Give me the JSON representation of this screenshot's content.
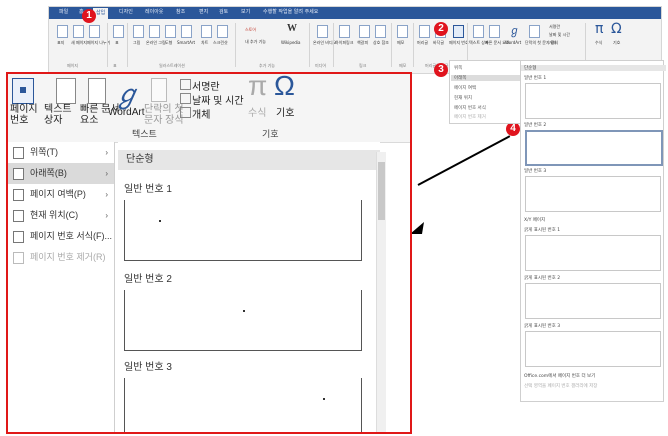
{
  "top_ribbon": {
    "tabs": [
      "파일",
      "홈",
      "삽입",
      "디자인",
      "레이아웃",
      "참조",
      "편지",
      "검토",
      "보기",
      "수행할 작업을 알려 주세요"
    ],
    "buttons": [
      "표지",
      "새 페이지",
      "페이지 나누기",
      "표",
      "그림",
      "온라인 그림",
      "도형",
      "SmartArt",
      "차트",
      "스크린샷",
      "스토어",
      "내 추가 기능",
      "Wikipedia",
      "온라인 비디오",
      "하이퍼링크",
      "책갈피",
      "상호 참조",
      "메모",
      "머리글",
      "바닥글",
      "페이지 번호",
      "텍스트 상자",
      "빠른 문서 요소",
      "WordArt",
      "단락의 첫 문자 장식",
      "서명란",
      "날짜 및 시간",
      "개체",
      "수식",
      "기호"
    ],
    "groups": [
      "페이지",
      "표",
      "일러스트레이션",
      "추가 기능",
      "미디어",
      "링크",
      "메모",
      "머리글/바닥글",
      "텍스트",
      "기호"
    ]
  },
  "badges": [
    "1",
    "2",
    "3",
    "4"
  ],
  "small_dropdown": [
    "위쪽",
    "아래쪽",
    "페이지 여백",
    "현재 위치",
    "페이지 번호 서식",
    "페이지 번호 제거"
  ],
  "small_gallery": {
    "head": "단순형",
    "items": [
      "일반 번호 1",
      "일반 번호 2",
      "일반 번호 3"
    ],
    "section": "X/Y 페이지",
    "bold_items": [
      "굵게 표시된 번호 1",
      "굵게 표시된 번호 2",
      "굵게 표시된 번호 3"
    ],
    "footer": [
      "Office.com에서 페이지 번호 더 보기",
      "선택 영역을 페이지 번호 갤러리에 저장"
    ]
  },
  "zoom": {
    "ribbon": {
      "page_number": "페이지\n번호",
      "text_box": "텍스트\n상자",
      "quick_parts": "빠른 문서\n요소",
      "wordart": "WordArt",
      "dropcap": "단락의 첫\n문자 장식",
      "signature": "서명란",
      "datetime": "날짜 및 시간",
      "object": "개체",
      "equation": "수식",
      "symbol": "기호",
      "group_text": "텍스트",
      "group_symbol": "기호"
    },
    "menu": [
      {
        "label": "위쪽(T)",
        "chevron": "›"
      },
      {
        "label": "아래쪽(B)",
        "chevron": "›"
      },
      {
        "label": "페이지 여백(P)",
        "chevron": "›"
      },
      {
        "label": "현재 위치(C)",
        "chevron": "›"
      },
      {
        "label": "페이지 번호 서식(F)...",
        "chevron": ""
      },
      {
        "label": "페이지 번호 제거(R)",
        "chevron": ""
      }
    ],
    "gallery_head": "단순형",
    "gallery_items": [
      "일반 번호 1",
      "일반 번호 2",
      "일반 번호 3"
    ]
  },
  "colors": {
    "accent": "#e01818",
    "tabbar": "#2b579a",
    "badge": "#e0141e"
  }
}
